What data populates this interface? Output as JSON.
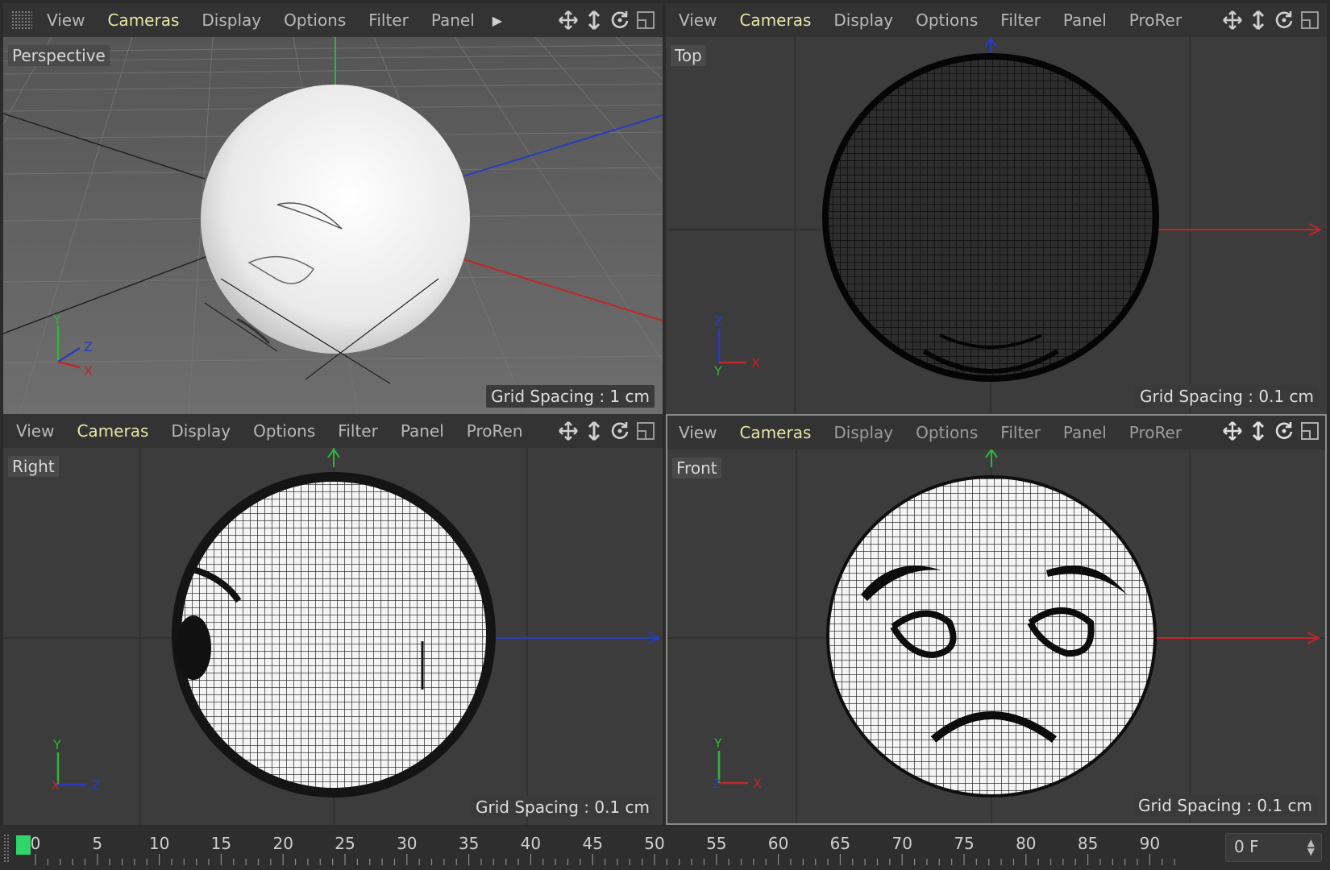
{
  "menu": {
    "view": "View",
    "cameras": "Cameras",
    "display": "Display",
    "options": "Options",
    "filter": "Filter",
    "panel": "Panel",
    "proren_tr": "ProRer",
    "proren_bl": "ProRen",
    "proren_br": "ProRer"
  },
  "viewports": {
    "perspective": {
      "label": "Perspective",
      "grid": "Grid Spacing : 1 cm"
    },
    "top": {
      "label": "Top",
      "grid": "Grid Spacing : 0.1 cm"
    },
    "right": {
      "label": "Right",
      "grid": "Grid Spacing : 0.1 cm"
    },
    "front": {
      "label": "Front",
      "grid": "Grid Spacing : 0.1 cm"
    }
  },
  "axes": {
    "x": "X",
    "y": "Y",
    "z": "Z"
  },
  "timeline": {
    "ticks": [
      "0",
      "5",
      "10",
      "15",
      "20",
      "25",
      "30",
      "35",
      "40",
      "45",
      "50",
      "55",
      "60",
      "65",
      "70",
      "75",
      "80",
      "85",
      "90"
    ],
    "current_frame": "0 F"
  },
  "icons": {
    "move": "move-icon",
    "zoom": "vertical-move-icon",
    "rotate": "rotate-icon",
    "maximize": "maximize-icon"
  },
  "colors": {
    "menu_active": "#e6e6a8",
    "axis_x": "#c0262a",
    "axis_y": "#2fb53a",
    "axis_z": "#2a3bbd",
    "timeline_marker": "#2fd56a"
  }
}
